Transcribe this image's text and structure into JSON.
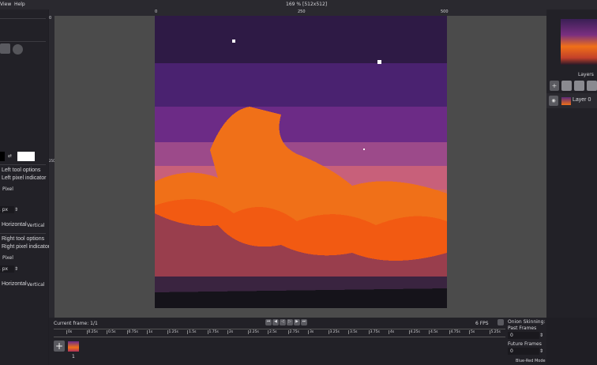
{
  "menu": {
    "items": [
      "View",
      "Help"
    ],
    "zoom": "169 %",
    "size": "[512x512]"
  },
  "left_panel": {
    "left_tool_options": "Left tool options",
    "left_indicator": "Left pixel indicator",
    "left_brush": "Pixel",
    "left_size": "1 px",
    "left_horizontal": "Horizontal",
    "left_vertical": "Vertical",
    "right_tool_options": "Right tool options",
    "right_indicator": "Right pixel indicator",
    "right_brush": "Pixel",
    "right_size": "1 px",
    "right_horizontal": "Horizontal",
    "right_vertical": "Vertical",
    "primary_color": "#000000",
    "secondary_color": "#ffffff"
  },
  "rulers": {
    "top": [
      "0",
      "250",
      "500"
    ],
    "left": [
      "0",
      "250"
    ]
  },
  "layers": {
    "title": "Layers",
    "items": [
      {
        "name": "Layer 0"
      }
    ]
  },
  "timeline": {
    "current_frame": "Current frame: 1/1",
    "fps": "6 FPS",
    "frame_number": "1",
    "ticks": [
      "0s",
      "0.25s",
      "0.5s",
      "0.75s",
      "1s",
      "1.25s",
      "1.5s",
      "1.75s",
      "2s",
      "2.25s",
      "2.5s",
      "2.75s",
      "3s",
      "3.25s",
      "3.5s",
      "3.75s",
      "4s",
      "4.25s",
      "4.5s",
      "4.75s",
      "5s",
      "5.25s"
    ]
  },
  "onion": {
    "title": "Onion Skinning:",
    "past_label": "Past Frames",
    "past_value": "0",
    "future_label": "Future Frames",
    "future_value": "0",
    "mode": "Blue-Red Mode"
  }
}
